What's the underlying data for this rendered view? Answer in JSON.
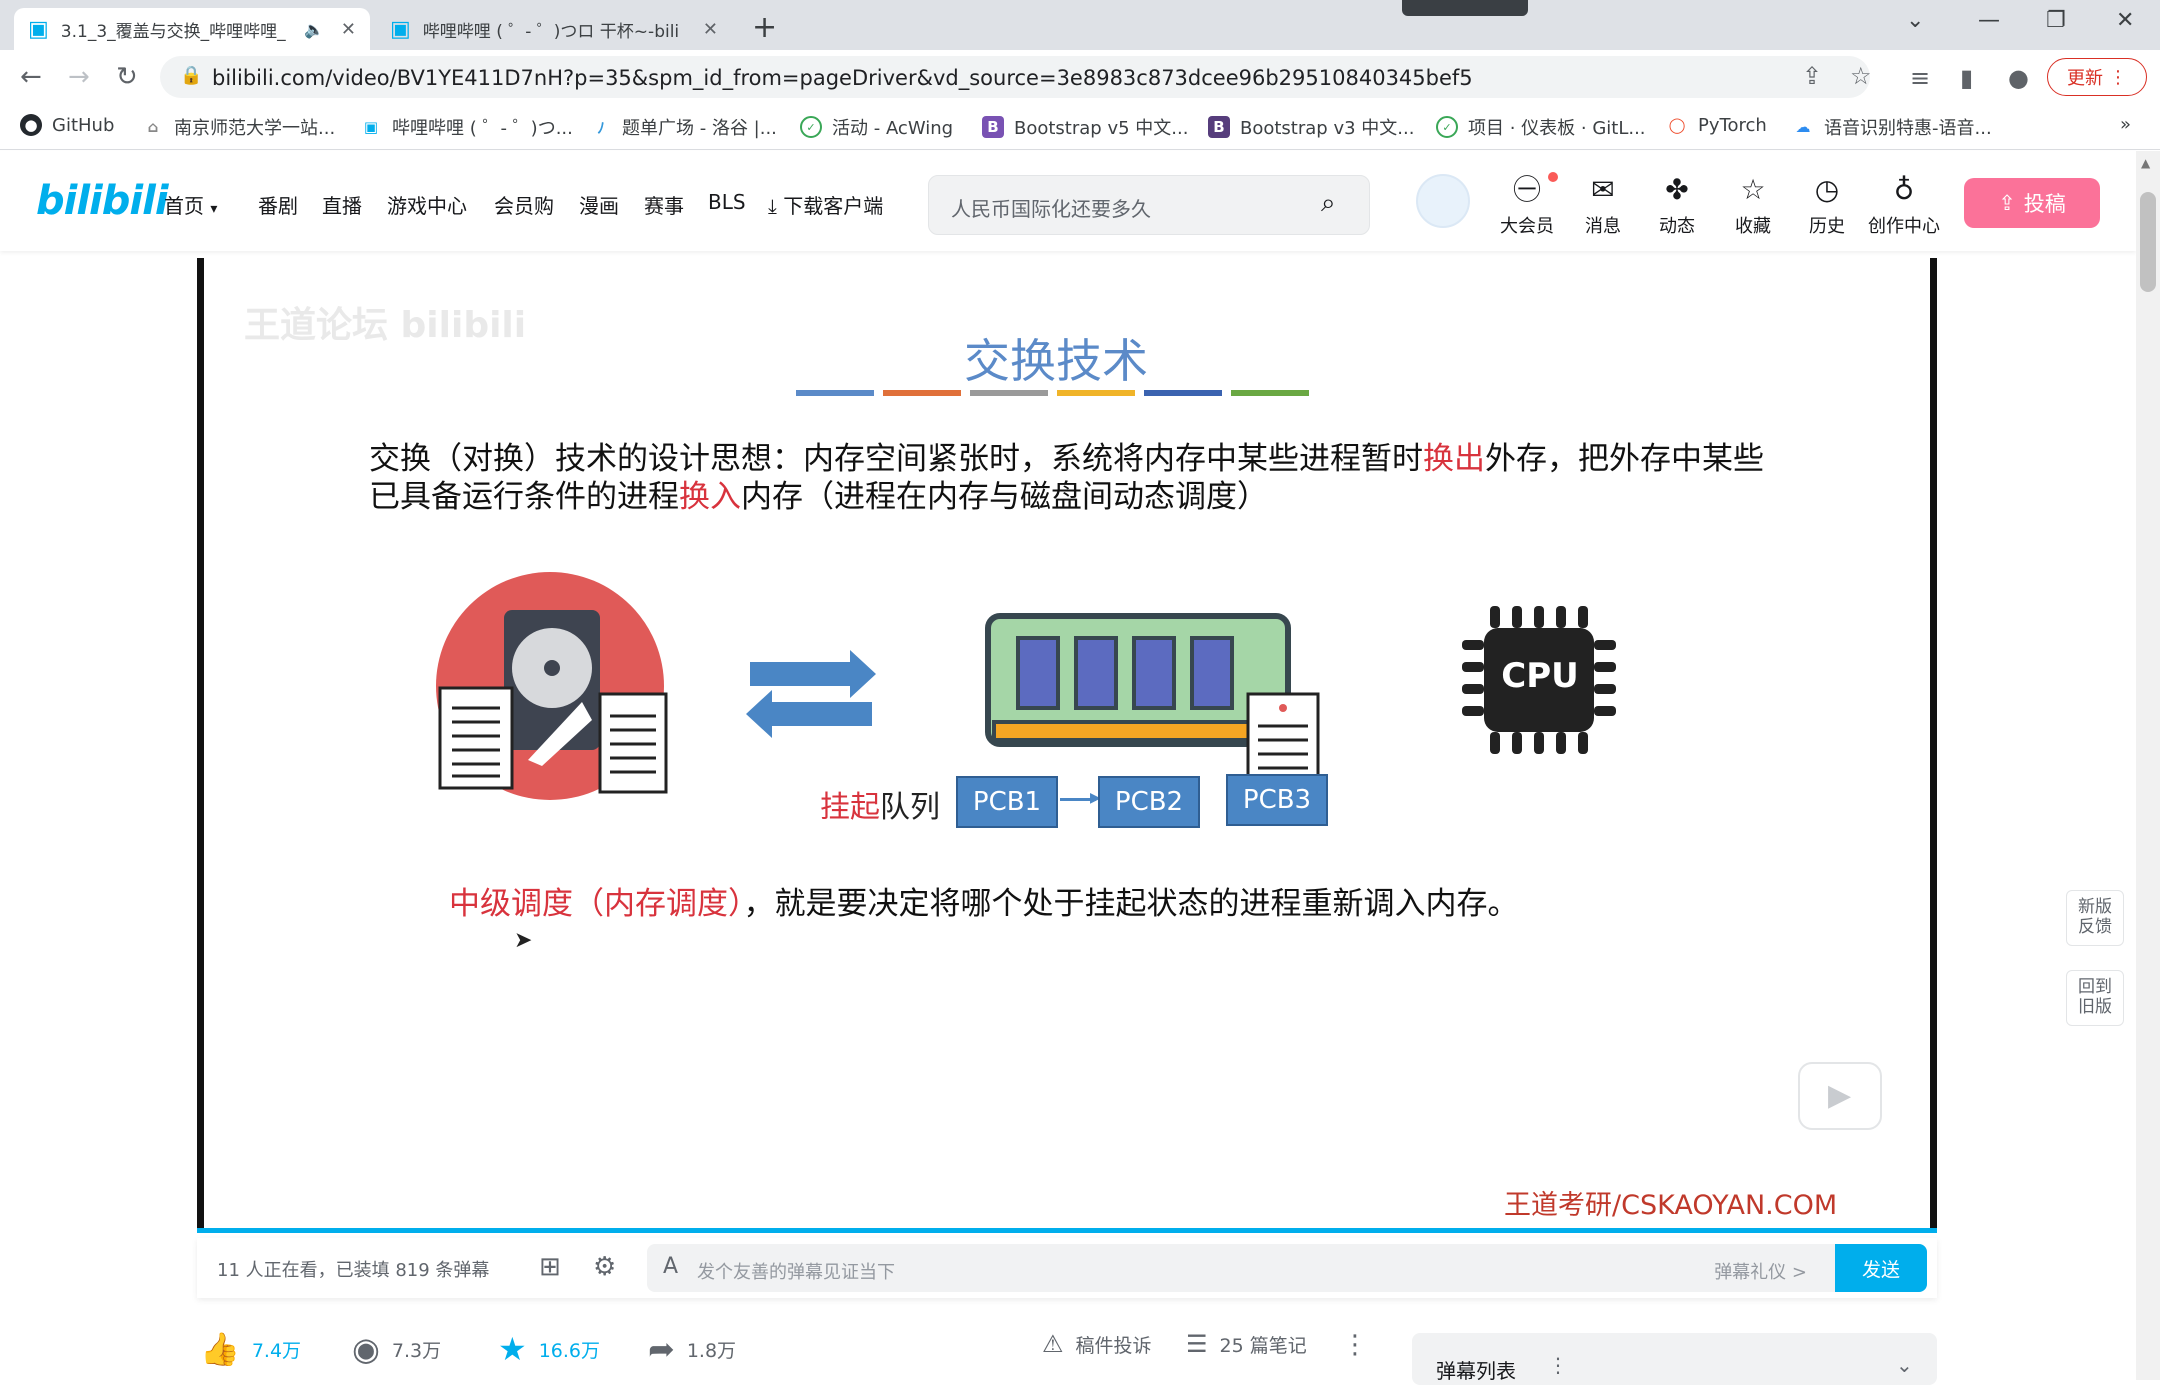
{
  "browser": {
    "tabs": [
      {
        "title": "3.1_3_覆盖与交换_哔哩哔哩_",
        "active": true
      },
      {
        "title": "哔哩哔哩 ( ゜- ゜)つロ 干杯~-bili",
        "active": false
      }
    ],
    "new_tab": "+",
    "url": "bilibili.com/video/BV1YE411D7nH?p=35&spm_id_from=pageDriver&vd_source=3e8983c873dcee96b29510840345bef5",
    "update_label": "更新",
    "bookmarks": [
      "GitHub",
      "南京师范大学一站...",
      "哔哩哔哩 ( ゜- ゜)つ...",
      "题单广场 - 洛谷 |...",
      "活动 - AcWing",
      "Bootstrap v5 中文...",
      "Bootstrap v3 中文...",
      "项目 · 仪表板 · GitL...",
      "PyTorch",
      "语音识别特惠-语音..."
    ],
    "more": "»"
  },
  "bili": {
    "logo": "bilibili",
    "nav": [
      "首页",
      "番剧",
      "直播",
      "游戏中心",
      "会员购",
      "漫画",
      "赛事",
      "BLS",
      "下载客户端"
    ],
    "search_placeholder": "人民币国际化还要多久",
    "user_items": [
      "大会员",
      "消息",
      "动态",
      "收藏",
      "历史",
      "创作中心"
    ],
    "upload": "投稿"
  },
  "slide": {
    "watermark": "王道论坛 bilibili",
    "title": "交换技术",
    "para_1": "交换（对换）技术的设计思想：内存空间紧张时，系统将内存中某些进程暂时",
    "para_red_1": "换出",
    "para_2": "外存，把外存中某些已具备运行条件的进程",
    "para_red_2": "换入",
    "para_3": "内存（进程在内存与磁盘间动态调度）",
    "suspend_red": "挂起",
    "suspend_rest": "队列",
    "pcbs": [
      "PCB1",
      "PCB2",
      "PCB3"
    ],
    "cpu": "CPU",
    "line_red": "中级调度（内存调度）",
    "line_rest": "，就是要决定将哪个处于挂起状态的进程重新调入内存。",
    "brand": "王道考研/CSKAOYAN.COM",
    "colors": {
      "title": "#5b8ac8",
      "red": "#d8333d",
      "pcb": "#4a86c5"
    }
  },
  "danmaku": {
    "info": "11 人正在看，已装填 819 条弹幕",
    "placeholder": "发个友善的弹幕见证当下",
    "etiquette": "弹幕礼仪 >",
    "send": "发送"
  },
  "actions": {
    "like": "7.4万",
    "coin": "7.3万",
    "fav": "16.6万",
    "share": "1.8万",
    "report": "稿件投诉",
    "notes": "25 篇笔记"
  },
  "side": {
    "feedback": "新版\n反馈",
    "old": "回到\n旧版"
  },
  "danmaku_list": "弹幕列表"
}
